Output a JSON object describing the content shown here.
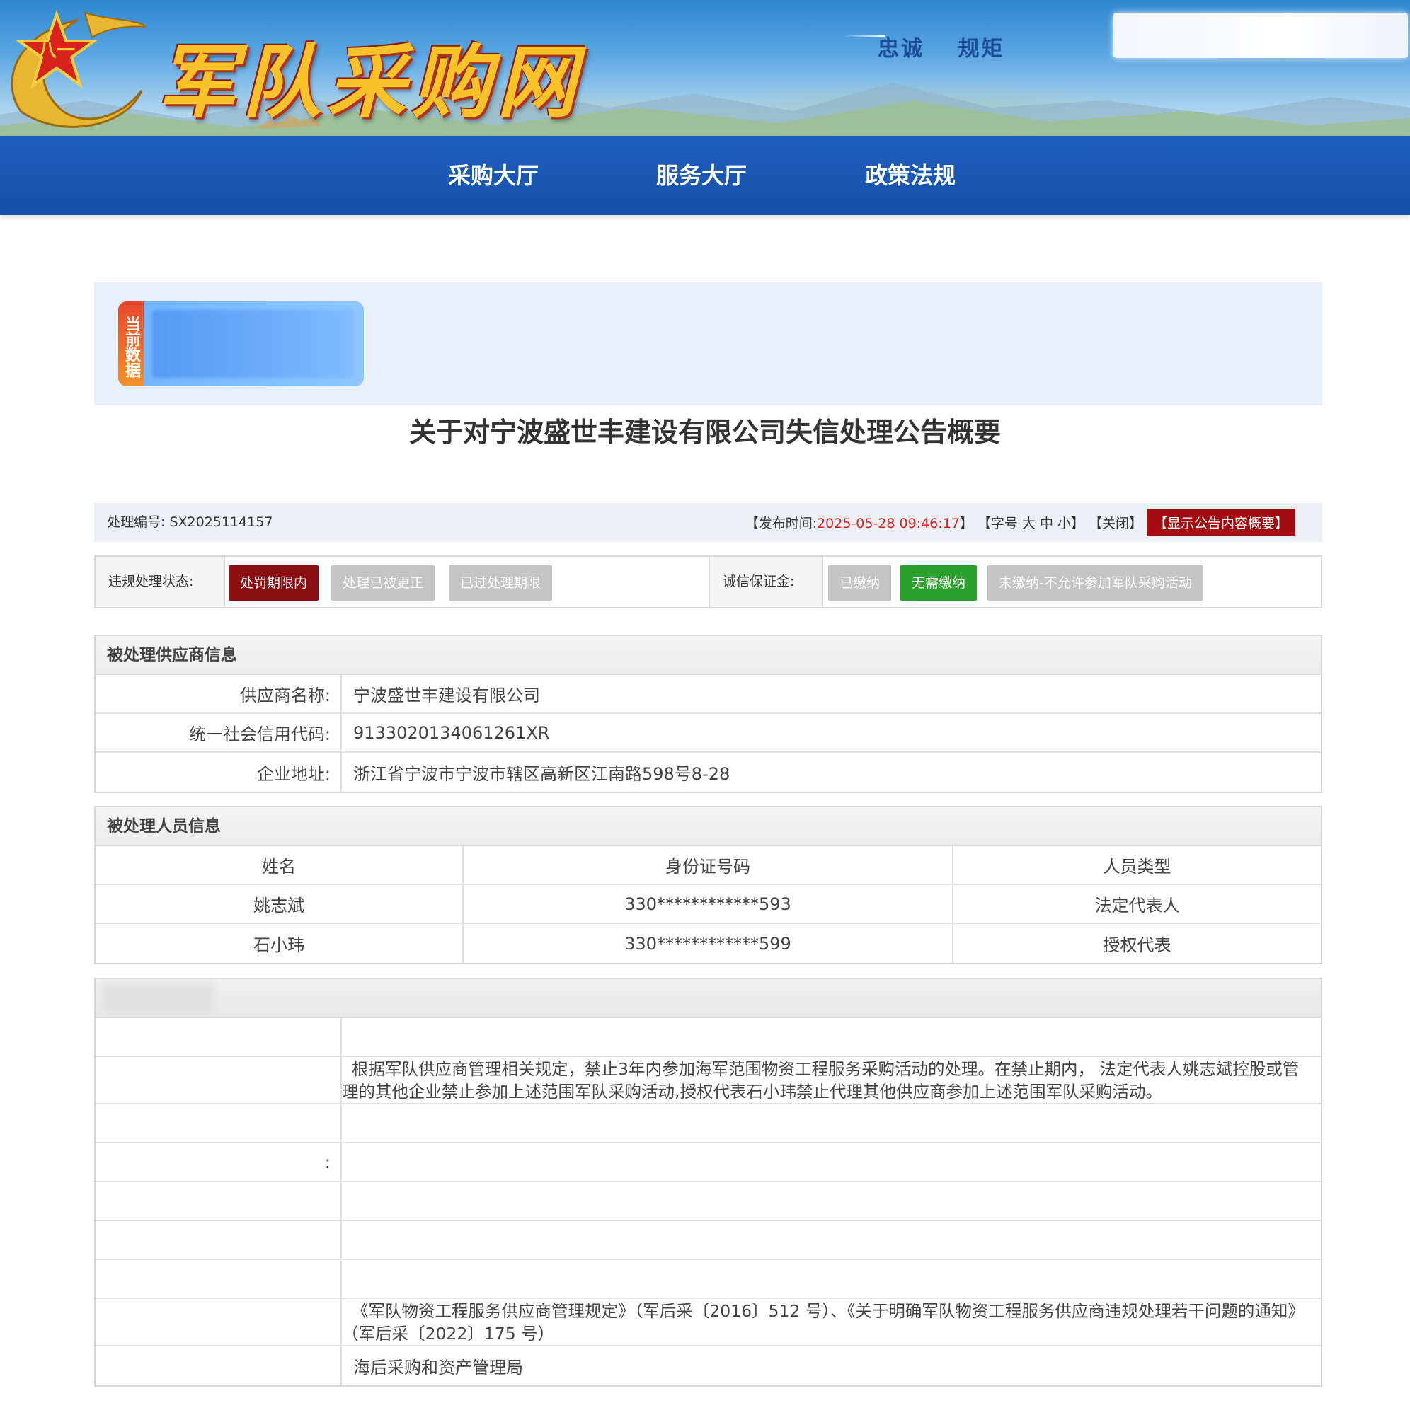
{
  "site": {
    "logo_text": "军队采购网",
    "slogan": "忠诚 规矩",
    "colors": {
      "nav": "#1f5fbf",
      "accent_red": "#a50c12",
      "green": "#2ca02c"
    }
  },
  "nav": {
    "items": [
      "采购大厅",
      "服务大厅",
      "政策法规"
    ]
  },
  "current_data_tag": "当前数据",
  "title": "关于对宁波盛世丰建设有限公司失信处理公告概要",
  "meta": {
    "case_label": "处理编号:",
    "case_number": "SX2025114157",
    "publish_prefix": "【发布时间:",
    "publish_time": "2025-05-28 09:46:17",
    "publish_suffix": "】",
    "font_size_label": "【字号",
    "font_large": "大",
    "font_medium": "中",
    "font_small": "小】",
    "close": "【关闭】",
    "show_summary": "【显示公告内容概要】"
  },
  "status": {
    "violation_label": "违规处理状态:",
    "violation_options": [
      "处罚期限内",
      "处理已被更正",
      "已过处理期限"
    ],
    "violation_active": "处罚期限内",
    "deposit_label": "诚信保证金:",
    "deposit_options": [
      "已缴纳",
      "无需缴纳",
      "未缴纳-不允许参加军队采购活动"
    ],
    "deposit_active": "无需缴纳"
  },
  "supplier": {
    "heading": "被处理供应商信息",
    "rows": [
      {
        "label": "供应商名称:",
        "value": "宁波盛世丰建设有限公司"
      },
      {
        "label": "统一社会信用代码:",
        "value": "9133020134061261XR"
      },
      {
        "label": "企业地址:",
        "value": "浙江省宁波市宁波市辖区高新区江南路598号8-28"
      }
    ]
  },
  "personnel": {
    "heading": "被处理人员信息",
    "columns": [
      "姓名",
      "身份证号码",
      "人员类型"
    ],
    "rows": [
      [
        "姚志斌",
        "330************593",
        "法定代表人"
      ],
      [
        "石小玮",
        "330************599",
        "授权代表"
      ]
    ]
  },
  "decision": {
    "punishment_text": "根据军队供应商管理相关规定，禁止3年内参加海军范围物资工程服务采购活动的处理。在禁止期内， 法定代表人姚志斌控股或管理的其他企业禁止参加上述范围军队采购活动,授权代表石小玮禁止代理其他供应商参加上述范围军队采购活动。",
    "basis_text": "《军队物资工程服务供应商管理规定》（军后采〔2016〕512 号）、《关于明确军队物资工程服务供应商违规处理若干问题的通知》（军后采〔2022〕175 号）",
    "authority_text": "海后采购和资产管理局",
    "colon_fragment": ":"
  }
}
